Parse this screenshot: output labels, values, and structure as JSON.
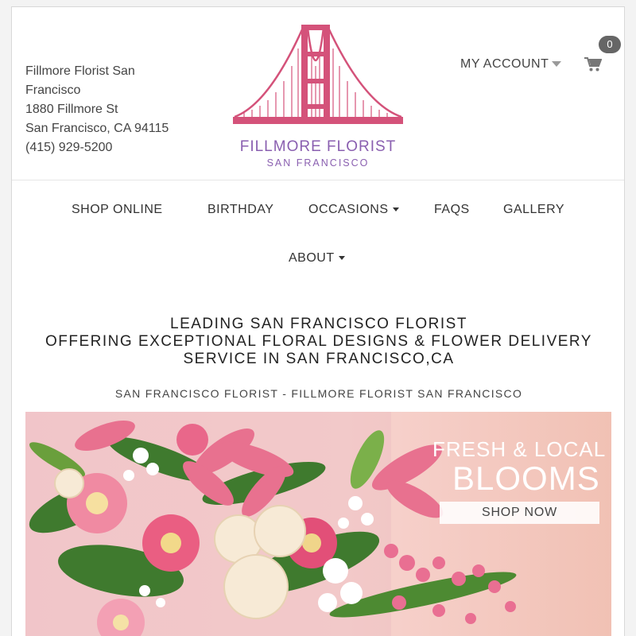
{
  "header": {
    "address_lines": [
      "Fillmore Florist San",
      "Francisco",
      "1880 Fillmore St",
      "San Francisco, CA 94115",
      "(415) 929-5200"
    ],
    "logo": {
      "name": "FILLMORE FLORIST",
      "sub": "SAN FRANCISCO",
      "icon": "golden-gate-bridge-icon",
      "color": "#d4527a",
      "text_color": "#8a5fb0"
    },
    "account_label": "MY ACCOUNT",
    "cart_count": "0"
  },
  "nav": {
    "items": [
      {
        "label": "SHOP ONLINE",
        "has_dropdown": false
      },
      {
        "label": "BIRTHDAY",
        "has_dropdown": false
      },
      {
        "label": "OCCASIONS",
        "has_dropdown": true
      },
      {
        "label": "FAQS",
        "has_dropdown": false
      },
      {
        "label": "GALLERY",
        "has_dropdown": false
      },
      {
        "label": "ABOUT",
        "has_dropdown": true
      }
    ]
  },
  "main": {
    "headline_lines": [
      "LEADING SAN FRANCISCO FLORIST",
      "OFFERING EXCEPTIONAL FLORAL DESIGNS & FLOWER DELIVERY",
      "SERVICE IN SAN FRANCISCO,CA"
    ],
    "subheading": "SAN FRANCISCO FLORIST - FILLMORE FLORIST SAN FRANCISCO"
  },
  "banner": {
    "line1": "FRESH & LOCAL",
    "line2": "BLOOMS",
    "button_label": "SHOP NOW"
  }
}
